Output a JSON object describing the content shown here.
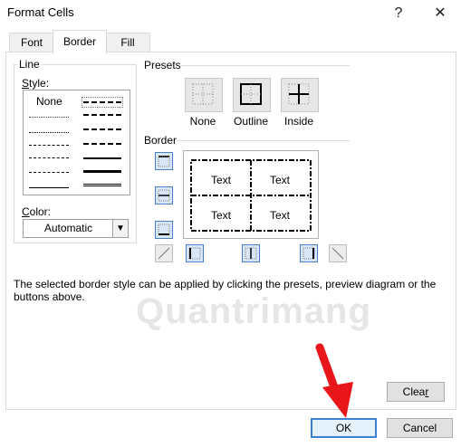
{
  "window": {
    "title": "Format Cells",
    "help_glyph": "?",
    "close_glyph": "✕"
  },
  "tabs": [
    {
      "label": "Font",
      "active": false
    },
    {
      "label": "Border",
      "active": true
    },
    {
      "label": "Fill",
      "active": false
    }
  ],
  "line_group": {
    "legend": "Line",
    "style_label": "Style:",
    "none_label": "None",
    "color_label": "Color:",
    "color_value": "Automatic"
  },
  "presets": {
    "legend": "Presets",
    "items": [
      {
        "label": "None"
      },
      {
        "label": "Outline"
      },
      {
        "label": "Inside"
      }
    ]
  },
  "border": {
    "legend": "Border",
    "preview_cells": [
      "Text",
      "Text",
      "Text",
      "Text"
    ]
  },
  "help_text": "The selected border style can be applied by clicking the presets, preview diagram or the buttons above.",
  "buttons": {
    "clear": "Clear",
    "ok": "OK",
    "cancel": "Cancel"
  },
  "watermark": "Quantrimang",
  "colors": {
    "selected_border": "#3c7fd5",
    "annotation_arrow": "#e8161b"
  }
}
